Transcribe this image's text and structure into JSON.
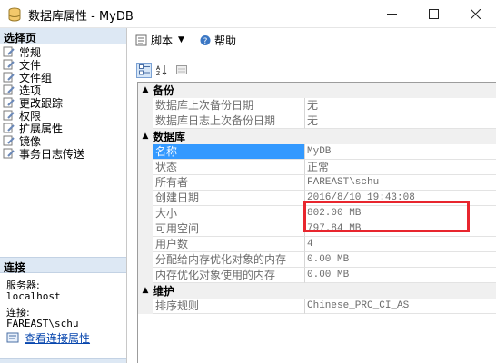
{
  "window": {
    "title": "数据库属性 - MyDB"
  },
  "left_pane": {
    "select_page_header": "选择页",
    "pages": [
      {
        "label": "常规"
      },
      {
        "label": "文件"
      },
      {
        "label": "文件组"
      },
      {
        "label": "选项"
      },
      {
        "label": "更改跟踪"
      },
      {
        "label": "权限"
      },
      {
        "label": "扩展属性"
      },
      {
        "label": "镜像"
      },
      {
        "label": "事务日志传送"
      }
    ],
    "connection_header": "连接",
    "server_label": "服务器:",
    "server_value": "localhost",
    "connection_label": "连接:",
    "connection_value": "FAREAST\\schu",
    "view_connection_link": "查看连接属性"
  },
  "toolbar": {
    "script_label": "脚本",
    "help_label": "帮助"
  },
  "grid": {
    "categories": [
      {
        "label": "备份"
      },
      {
        "label": "数据库"
      },
      {
        "label": "维护"
      }
    ],
    "backup": [
      {
        "name": "数据库上次备份日期",
        "value": "无"
      },
      {
        "name": "数据库日志上次备份日期",
        "value": "无"
      }
    ],
    "database": [
      {
        "name": "名称",
        "value": "MyDB"
      },
      {
        "name": "状态",
        "value": "正常"
      },
      {
        "name": "所有者",
        "value": "FAREAST\\schu"
      },
      {
        "name": "创建日期",
        "value": "2016/8/10 19:43:08"
      },
      {
        "name": "大小",
        "value": "802.00 MB"
      },
      {
        "name": "可用空间",
        "value": "797.84 MB"
      },
      {
        "name": "用户数",
        "value": "4"
      },
      {
        "name": "分配给内存优化对象的内存",
        "value": "0.00 MB"
      },
      {
        "name": "内存优化对象使用的内存",
        "value": "0.00 MB"
      }
    ],
    "maintenance": [
      {
        "name": "排序规则",
        "value": "Chinese_PRC_CI_AS"
      }
    ]
  },
  "colors": {
    "highlight_box": "#e8262e",
    "selection": "#3399ff",
    "category_bg": "#f0f0f0"
  }
}
